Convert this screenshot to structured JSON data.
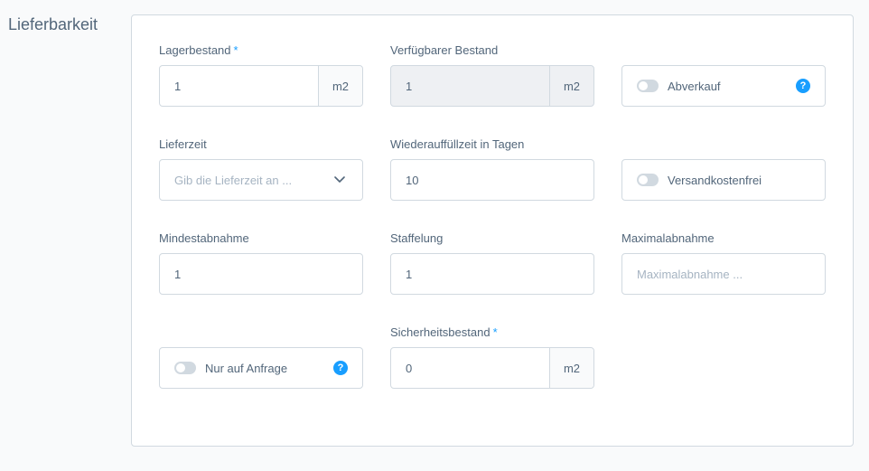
{
  "section": {
    "title": "Lieferbarkeit"
  },
  "fields": {
    "lagerbestand": {
      "label": "Lagerbestand",
      "required": "*",
      "value": "1",
      "unit": "m2"
    },
    "verfuegbar": {
      "label": "Verfügbarer Bestand",
      "value": "1",
      "unit": "m2"
    },
    "abverkauf": {
      "label": "Abverkauf",
      "help": "?"
    },
    "lieferzeit": {
      "label": "Lieferzeit",
      "placeholder": "Gib die Lieferzeit an ..."
    },
    "wiederauffuell": {
      "label": "Wiederauffüllzeit in Tagen",
      "value": "10"
    },
    "versandkostenfrei": {
      "label": "Versandkostenfrei"
    },
    "mindestabnahme": {
      "label": "Mindestabnahme",
      "value": "1"
    },
    "staffelung": {
      "label": "Staffelung",
      "value": "1"
    },
    "maximalabnahme": {
      "label": "Maximalabnahme",
      "placeholder": "Maximalabnahme ..."
    },
    "anfrage": {
      "label": "Nur auf Anfrage",
      "help": "?"
    },
    "sicherheitsbestand": {
      "label": "Sicherheitsbestand",
      "required": "*",
      "value": "0",
      "unit": "m2"
    }
  },
  "colors": {
    "accent": "#189eff",
    "border": "#d1d9e0",
    "text": "#52667a",
    "placeholder": "#a6b4c2",
    "disabled_bg": "#eef0f3"
  },
  "icons": {
    "help": "question-circle-icon",
    "dropdown": "chevron-down-icon",
    "toggle": "switch-off"
  }
}
